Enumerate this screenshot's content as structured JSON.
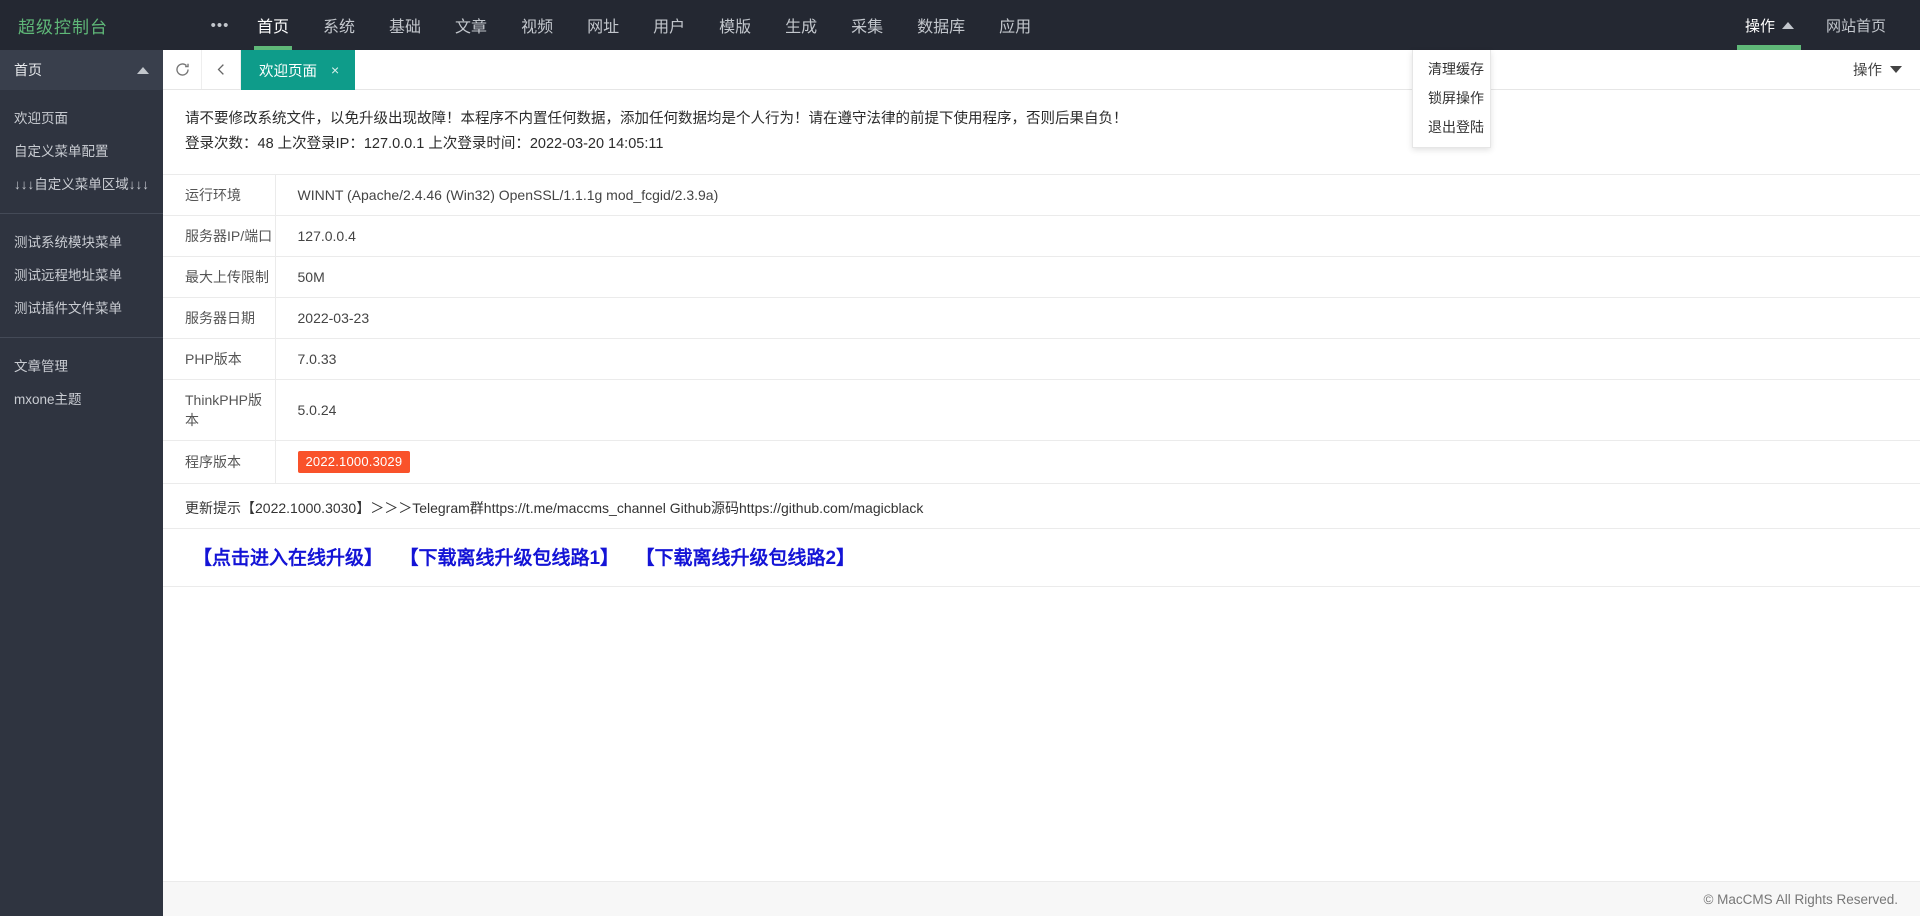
{
  "header": {
    "logo": "超级控制台",
    "dots": "•••",
    "nav": [
      {
        "label": "首页",
        "active": true
      },
      {
        "label": "系统",
        "active": false
      },
      {
        "label": "基础",
        "active": false
      },
      {
        "label": "文章",
        "active": false
      },
      {
        "label": "视频",
        "active": false
      },
      {
        "label": "网址",
        "active": false
      },
      {
        "label": "用户",
        "active": false
      },
      {
        "label": "模版",
        "active": false
      },
      {
        "label": "生成",
        "active": false
      },
      {
        "label": "采集",
        "active": false
      },
      {
        "label": "数据库",
        "active": false
      },
      {
        "label": "应用",
        "active": false
      }
    ],
    "action_label": "操作",
    "site_home_label": "网站首页"
  },
  "dropdown": {
    "items": [
      {
        "label": "清理缓存"
      },
      {
        "label": "锁屏操作"
      },
      {
        "label": "退出登陆"
      }
    ]
  },
  "sidebar": {
    "group_title": "首页",
    "items_top": [
      {
        "label": "欢迎页面"
      },
      {
        "label": "自定义菜单配置"
      },
      {
        "label": "↓↓↓自定义菜单区域↓↓↓"
      }
    ],
    "items_mid": [
      {
        "label": "测试系统模块菜单"
      },
      {
        "label": "测试远程地址菜单"
      },
      {
        "label": "测试插件文件菜单"
      }
    ],
    "items_bottom": [
      {
        "label": "文章管理"
      },
      {
        "label": "mxone主题"
      }
    ]
  },
  "tabbar": {
    "refresh_icon": "refresh-icon",
    "back_icon": "chevron-left-icon",
    "tab_label": "欢迎页面",
    "tab_close": "×",
    "action_label": "操作"
  },
  "content": {
    "notice_line1": "请不要修改系统文件，以免升级出现故障！本程序不内置任何数据，添加任何数据均是个人行为！请在遵守法律的前提下使用程序，否则后果自负！",
    "notice_line2": "登录次数：48 上次登录IP：127.0.0.1 上次登录时间：2022-03-20 14:05:11",
    "table": [
      {
        "key": "运行环境",
        "value": "WINNT (Apache/2.4.46 (Win32) OpenSSL/1.1.1g mod_fcgid/2.3.9a)",
        "badge": false
      },
      {
        "key": "服务器IP/端口",
        "value": "127.0.0.4",
        "badge": false
      },
      {
        "key": "最大上传限制",
        "value": "50M",
        "badge": false
      },
      {
        "key": "服务器日期",
        "value": "2022-03-23",
        "badge": false
      },
      {
        "key": "PHP版本",
        "value": "7.0.33",
        "badge": false
      },
      {
        "key": "ThinkPHP版本",
        "value": "5.0.24",
        "badge": false
      },
      {
        "key": "程序版本",
        "value": "2022.1000.3029",
        "badge": true
      }
    ],
    "update_tip": "更新提示【2022.1000.3030】＞＞＞Telegram群https://t.me/maccms_channel   Github源码https://github.com/magicblack",
    "links": [
      {
        "label": "【点击进入在线升级】"
      },
      {
        "label": "【下载离线升级包线路1】"
      },
      {
        "label": "【下载离线升级包线路2】"
      }
    ]
  },
  "footer": {
    "copyright": "© MacCMS All Rights Reserved."
  },
  "colors": {
    "header_bg": "#242832",
    "sidebar_bg": "#2f3440",
    "accent_green": "#5fb878",
    "tab_teal": "#0e9c8a",
    "badge_orange": "#f9522a",
    "link_blue": "#1414d6"
  }
}
